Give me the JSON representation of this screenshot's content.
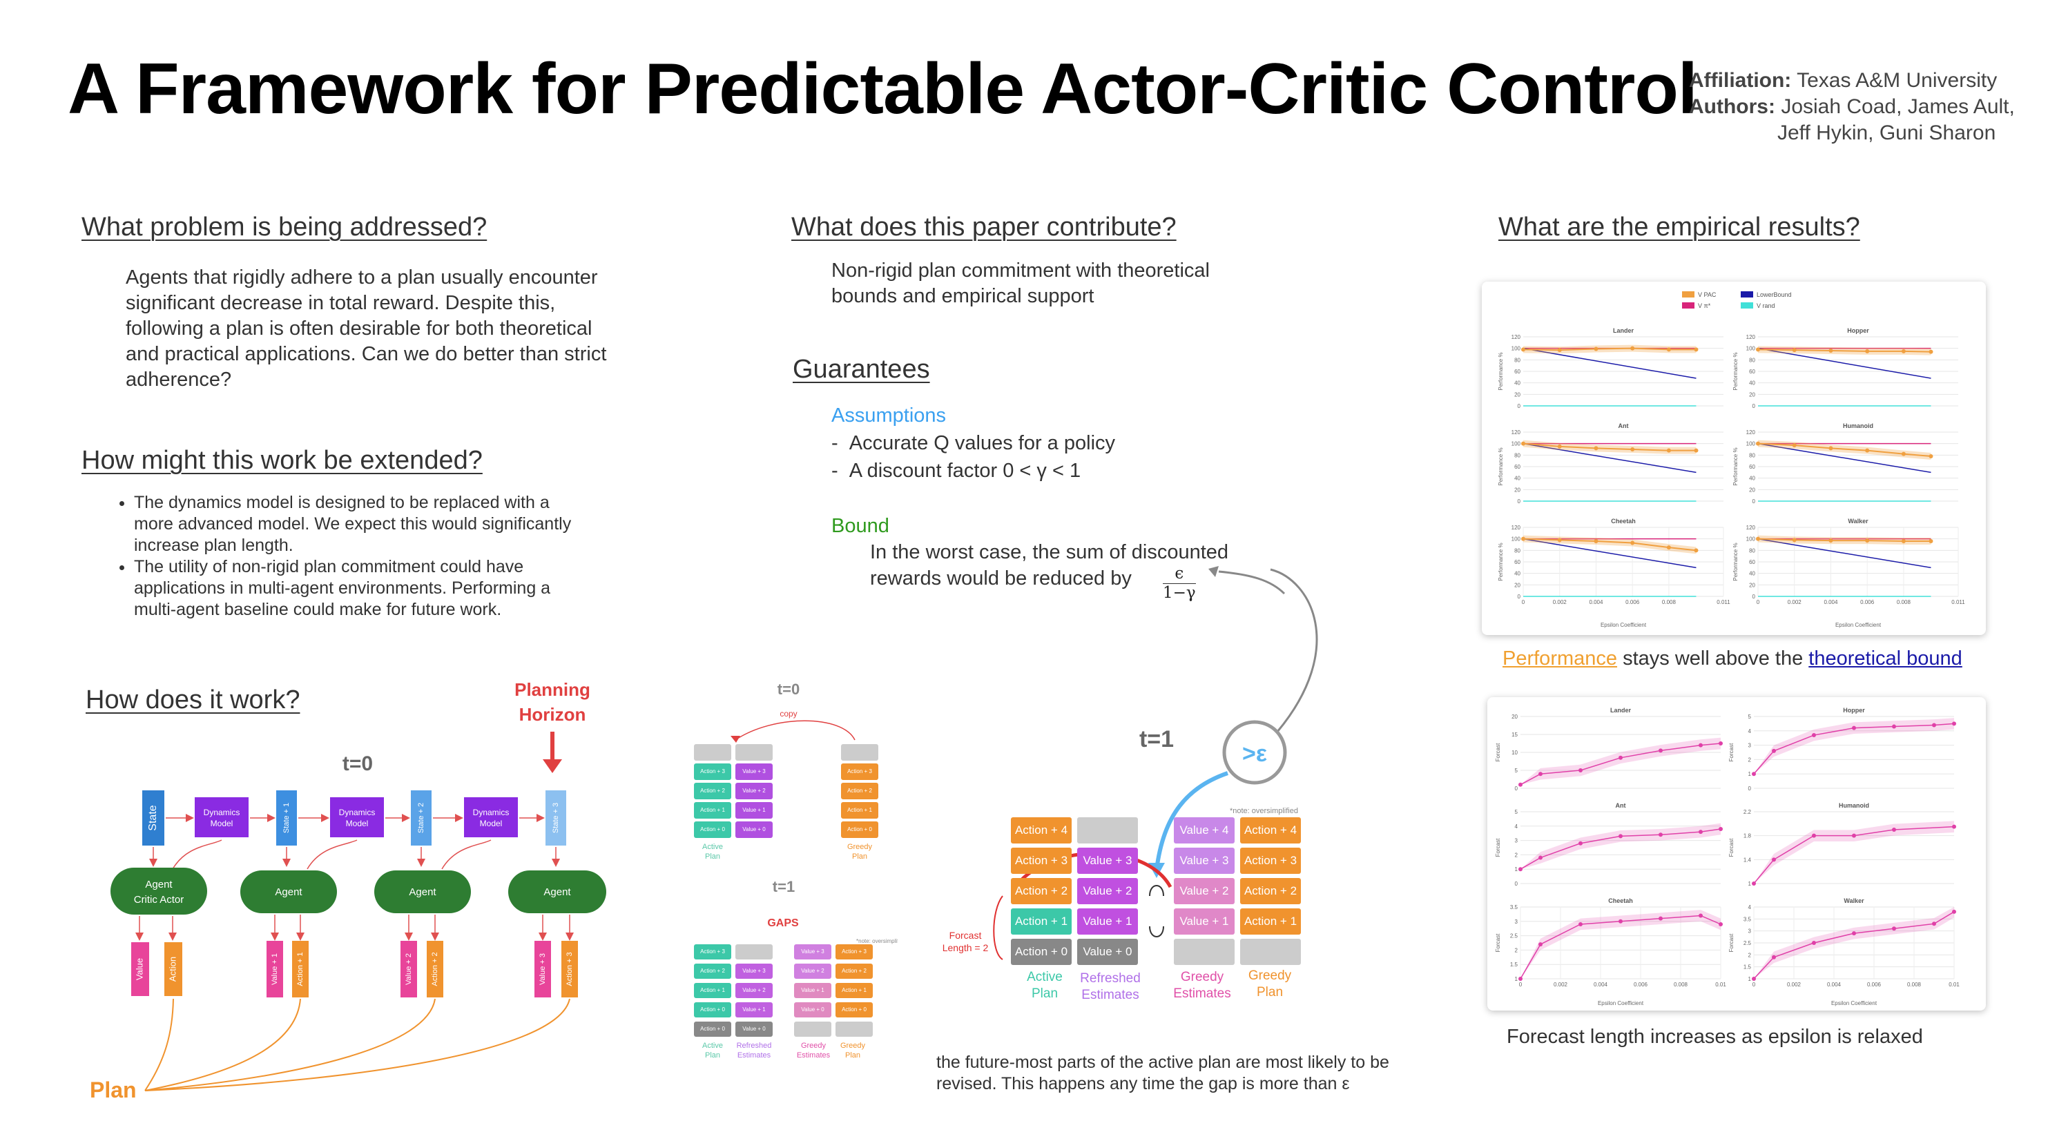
{
  "title": "A Framework for Predictable Actor-Critic Control",
  "affiliation": {
    "label": "Affiliation:",
    "value": "Texas A&M University"
  },
  "authors": {
    "label": "Authors:",
    "line1": "Josiah Coad, James Ault,",
    "line2": "Jeff Hykin, Guni Sharon"
  },
  "problem": {
    "heading": "What problem is being addressed?",
    "text": "Agents that rigidly adhere to a plan usually encounter significant decrease in total reward. Despite this, following a plan is often desirable for both theoretical and practical applications. Can we do better than strict adherence?"
  },
  "extend": {
    "heading": "How might this work be extended?",
    "bullets": [
      "The dynamics model is designed to be replaced with a more advanced model. We expect this would significantly increase plan length.",
      "The utility of non-rigid plan commitment could have applications in multi-agent environments. Performing a multi-agent baseline could make for future work."
    ]
  },
  "how": {
    "heading": "How does it work?",
    "planning_horizon": [
      "Planning",
      "Horizon"
    ],
    "t0": "t=0",
    "state": "State",
    "dynamics": [
      "Dynamics",
      "Model"
    ],
    "states": [
      "State + 1",
      "State + 2",
      "State + 3"
    ],
    "agent": "Agent",
    "agent_critic_actor": [
      "Agent",
      "Critic  Actor"
    ],
    "value": "Value",
    "action": "Action",
    "values": [
      "Value + 1",
      "Value + 2",
      "Value + 3"
    ],
    "actions": [
      "Action + 1",
      "Action + 2",
      "Action + 3"
    ],
    "plan": "Plan"
  },
  "contrib": {
    "heading": "What does this paper contribute?",
    "text": "Non-rigid plan commitment with theoretical bounds and empirical support"
  },
  "guarantees": {
    "heading": "Guarantees",
    "assumptions_title": "Assumptions",
    "assumptions": [
      "Accurate Q values for a policy",
      "A discount factor 0 < γ < 1"
    ],
    "bound_title": "Bound",
    "bound_text_1": "In the worst case, the sum of discounted",
    "bound_text_2": "rewards would be reduced by",
    "frac_num": "ϵ",
    "frac_den": "1−γ"
  },
  "small_diagram": {
    "t0": "t=0",
    "copy": "copy",
    "t1": "t=1",
    "gaps": "GAPS",
    "note": "*note: oversimplified",
    "active_plan": [
      "Active",
      "Plan"
    ],
    "greedy_plan": [
      "Greedy",
      "Plan"
    ],
    "refreshed": [
      "Refreshed",
      "Estimates"
    ],
    "greedy_est": [
      "Greedy",
      "Estimates"
    ],
    "actions": [
      "Action + 3",
      "Action + 2",
      "Action + 1",
      "Action + 0"
    ],
    "values": [
      "Value + 3",
      "Value + 2",
      "Value + 1",
      "Value + 0"
    ]
  },
  "big_diagram": {
    "t1": "t=1",
    "eps": ">ε",
    "note": "*note: oversimplified",
    "forecast": [
      "Forcast",
      "Length = 2"
    ],
    "actions": [
      "Action + 4",
      "Action + 3",
      "Action + 2",
      "Action + 1",
      "Action + 0"
    ],
    "values": [
      "Value + 4",
      "Value + 3",
      "Value + 2",
      "Value + 1",
      "Value + 0"
    ],
    "labels": {
      "active": [
        "Active",
        "Plan"
      ],
      "refreshed": [
        "Refreshed",
        "Estimates"
      ],
      "greedy_est": [
        "Greedy",
        "Estimates"
      ],
      "greedy_plan": [
        "Greedy",
        "Plan"
      ]
    }
  },
  "caption_mid": [
    "the future-most parts of the active plan are most likely to be",
    "revised. This happens any time the gap is more than ε"
  ],
  "results": {
    "heading": "What are the empirical results?",
    "caption1_part1": "Performance",
    "caption1_part2": " stays well above the ",
    "caption1_part3": "theoretical bound",
    "caption2": "Forecast length increases as epsilon is relaxed"
  },
  "chart_data": [
    {
      "type": "line",
      "legend": [
        "V PAC",
        "LowerBound",
        "V π*",
        "V rand"
      ],
      "colors": {
        "pac": "#f0a040",
        "lower": "#1a1aa8",
        "vstar": "#d8247a",
        "vrand": "#40e0d8"
      },
      "ylabel": "Performance %",
      "xlabel": "Epsilon Coefficient",
      "panels": [
        {
          "title": "Lander",
          "xlim": [
            0,
            0.011
          ],
          "ylim": [
            0,
            120
          ],
          "yticks": [
            0,
            20,
            40,
            60,
            80,
            100,
            120
          ],
          "xticks": [
            0,
            0.002,
            0.004,
            0.006,
            0.008,
            0.011
          ],
          "pac": [
            [
              0,
              98
            ],
            [
              0.002,
              97
            ],
            [
              0.004,
              99
            ],
            [
              0.006,
              100
            ],
            [
              0.008,
              98
            ],
            [
              0.0095,
              98
            ]
          ],
          "lower": [
            [
              0,
              100
            ],
            [
              0.0095,
              48
            ]
          ],
          "vstar": 100,
          "vrand": 0
        },
        {
          "title": "Hopper",
          "xlim": [
            0,
            0.011
          ],
          "ylim": [
            0,
            120
          ],
          "yticks": [
            0,
            20,
            40,
            60,
            80,
            100,
            120
          ],
          "xticks": [
            0,
            0.002,
            0.004,
            0.006,
            0.008,
            0.011
          ],
          "pac": [
            [
              0,
              98
            ],
            [
              0.002,
              97
            ],
            [
              0.004,
              96
            ],
            [
              0.006,
              95
            ],
            [
              0.008,
              95
            ],
            [
              0.0095,
              94
            ]
          ],
          "lower": [
            [
              0,
              100
            ],
            [
              0.0095,
              48
            ]
          ],
          "vstar": 100,
          "vrand": 0
        },
        {
          "title": "Ant",
          "xlim": [
            0,
            0.011
          ],
          "ylim": [
            0,
            120
          ],
          "yticks": [
            0,
            20,
            40,
            60,
            80,
            100,
            120
          ],
          "xticks": [
            0,
            0.002,
            0.004,
            0.006,
            0.008,
            0.011
          ],
          "pac": [
            [
              0,
              100
            ],
            [
              0.002,
              95
            ],
            [
              0.004,
              92
            ],
            [
              0.006,
              90
            ],
            [
              0.008,
              88
            ],
            [
              0.0095,
              88
            ]
          ],
          "lower": [
            [
              0,
              100
            ],
            [
              0.0095,
              50
            ]
          ],
          "vstar": 100,
          "vrand": 0
        },
        {
          "title": "Humanoid",
          "xlim": [
            0,
            0.011
          ],
          "ylim": [
            0,
            120
          ],
          "yticks": [
            0,
            20,
            40,
            60,
            80,
            100,
            120
          ],
          "xticks": [
            0,
            0.002,
            0.004,
            0.006,
            0.008,
            0.011
          ],
          "pac": [
            [
              0,
              100
            ],
            [
              0.002,
              97
            ],
            [
              0.004,
              92
            ],
            [
              0.006,
              88
            ],
            [
              0.008,
              82
            ],
            [
              0.0095,
              78
            ]
          ],
          "lower": [
            [
              0,
              100
            ],
            [
              0.0095,
              50
            ]
          ],
          "vstar": 100,
          "vrand": 0
        },
        {
          "title": "Cheetah",
          "xlim": [
            0,
            0.011
          ],
          "ylim": [
            0,
            120
          ],
          "yticks": [
            0,
            20,
            40,
            60,
            80,
            100,
            120
          ],
          "xticks": [
            0,
            0.002,
            0.004,
            0.006,
            0.008,
            0.011
          ],
          "pac": [
            [
              0,
              100
            ],
            [
              0.002,
              98
            ],
            [
              0.004,
              96
            ],
            [
              0.006,
              93
            ],
            [
              0.008,
              85
            ],
            [
              0.0095,
              80
            ]
          ],
          "lower": [
            [
              0,
              100
            ],
            [
              0.0095,
              50
            ]
          ],
          "vstar": 100,
          "vrand": 0
        },
        {
          "title": "Walker",
          "xlim": [
            0,
            0.011
          ],
          "ylim": [
            0,
            120
          ],
          "yticks": [
            0,
            20,
            40,
            60,
            80,
            100,
            120
          ],
          "xticks": [
            0,
            0.002,
            0.004,
            0.006,
            0.008,
            0.011
          ],
          "pac": [
            [
              0,
              100
            ],
            [
              0.002,
              98
            ],
            [
              0.004,
              97
            ],
            [
              0.006,
              97
            ],
            [
              0.008,
              96
            ],
            [
              0.0095,
              96
            ]
          ],
          "lower": [
            [
              0,
              100
            ],
            [
              0.0095,
              50
            ]
          ],
          "vstar": 100,
          "vrand": 0
        }
      ]
    },
    {
      "type": "line",
      "ylabel": "Forcast",
      "xlabel": "Epsilon Coefficient",
      "color": "#e040a8",
      "panels": [
        {
          "title": "Lander",
          "xlim": [
            0,
            0.01
          ],
          "ylim": [
            0,
            20
          ],
          "yticks": [
            0,
            5,
            10,
            15,
            20
          ],
          "xticks": [
            0,
            0.002,
            0.004,
            0.006,
            0.008,
            0.01
          ],
          "x": [
            0,
            0.001,
            0.003,
            0.005,
            0.007,
            0.009,
            0.01
          ],
          "y": [
            1,
            4,
            5,
            8.5,
            10.5,
            12,
            12.5
          ]
        },
        {
          "title": "Hopper",
          "xlim": [
            0,
            0.01
          ],
          "ylim": [
            0,
            5
          ],
          "yticks": [
            0,
            1,
            2,
            3,
            4,
            5
          ],
          "xticks": [
            0,
            0.002,
            0.004,
            0.006,
            0.008,
            0.01
          ],
          "x": [
            0,
            0.001,
            0.003,
            0.005,
            0.007,
            0.009,
            0.01
          ],
          "y": [
            1,
            2.6,
            3.7,
            4.2,
            4.3,
            4.4,
            4.5
          ]
        },
        {
          "title": "Ant",
          "xlim": [
            0,
            0.01
          ],
          "ylim": [
            0,
            5
          ],
          "yticks": [
            0,
            1,
            2,
            3,
            4,
            5
          ],
          "xticks": [
            0,
            0.002,
            0.004,
            0.006,
            0.008,
            0.01
          ],
          "x": [
            0,
            0.001,
            0.003,
            0.005,
            0.007,
            0.009,
            0.01
          ],
          "y": [
            1,
            1.8,
            2.8,
            3.3,
            3.4,
            3.6,
            3.8
          ]
        },
        {
          "title": "Humanoid",
          "xlim": [
            0,
            0.01
          ],
          "ylim": [
            1,
            2.2
          ],
          "yticks": [
            1,
            1.4,
            1.8,
            2.2
          ],
          "xticks": [
            0,
            0.002,
            0.004,
            0.006,
            0.008,
            0.01
          ],
          "x": [
            0,
            0.001,
            0.003,
            0.005,
            0.007,
            0.01
          ],
          "y": [
            1,
            1.4,
            1.8,
            1.8,
            1.9,
            1.95
          ]
        },
        {
          "title": "Cheetah",
          "xlim": [
            0,
            0.01
          ],
          "ylim": [
            1,
            3.5
          ],
          "yticks": [
            1,
            1.5,
            2,
            2.5,
            3,
            3.5
          ],
          "xticks": [
            0,
            0.002,
            0.004,
            0.006,
            0.008,
            0.01
          ],
          "x": [
            0,
            0.001,
            0.003,
            0.005,
            0.007,
            0.009,
            0.01
          ],
          "y": [
            1,
            2.2,
            2.9,
            3.0,
            3.1,
            3.2,
            2.9
          ]
        },
        {
          "title": "Walker",
          "xlim": [
            0,
            0.01
          ],
          "ylim": [
            1,
            4
          ],
          "yticks": [
            1,
            1.5,
            2,
            2.5,
            3,
            3.5,
            4
          ],
          "xticks": [
            0,
            0.002,
            0.004,
            0.006,
            0.008,
            0.01
          ],
          "x": [
            0,
            0.001,
            0.003,
            0.005,
            0.007,
            0.009,
            0.01
          ],
          "y": [
            1,
            1.9,
            2.5,
            2.9,
            3.1,
            3.3,
            3.8
          ]
        }
      ]
    }
  ]
}
